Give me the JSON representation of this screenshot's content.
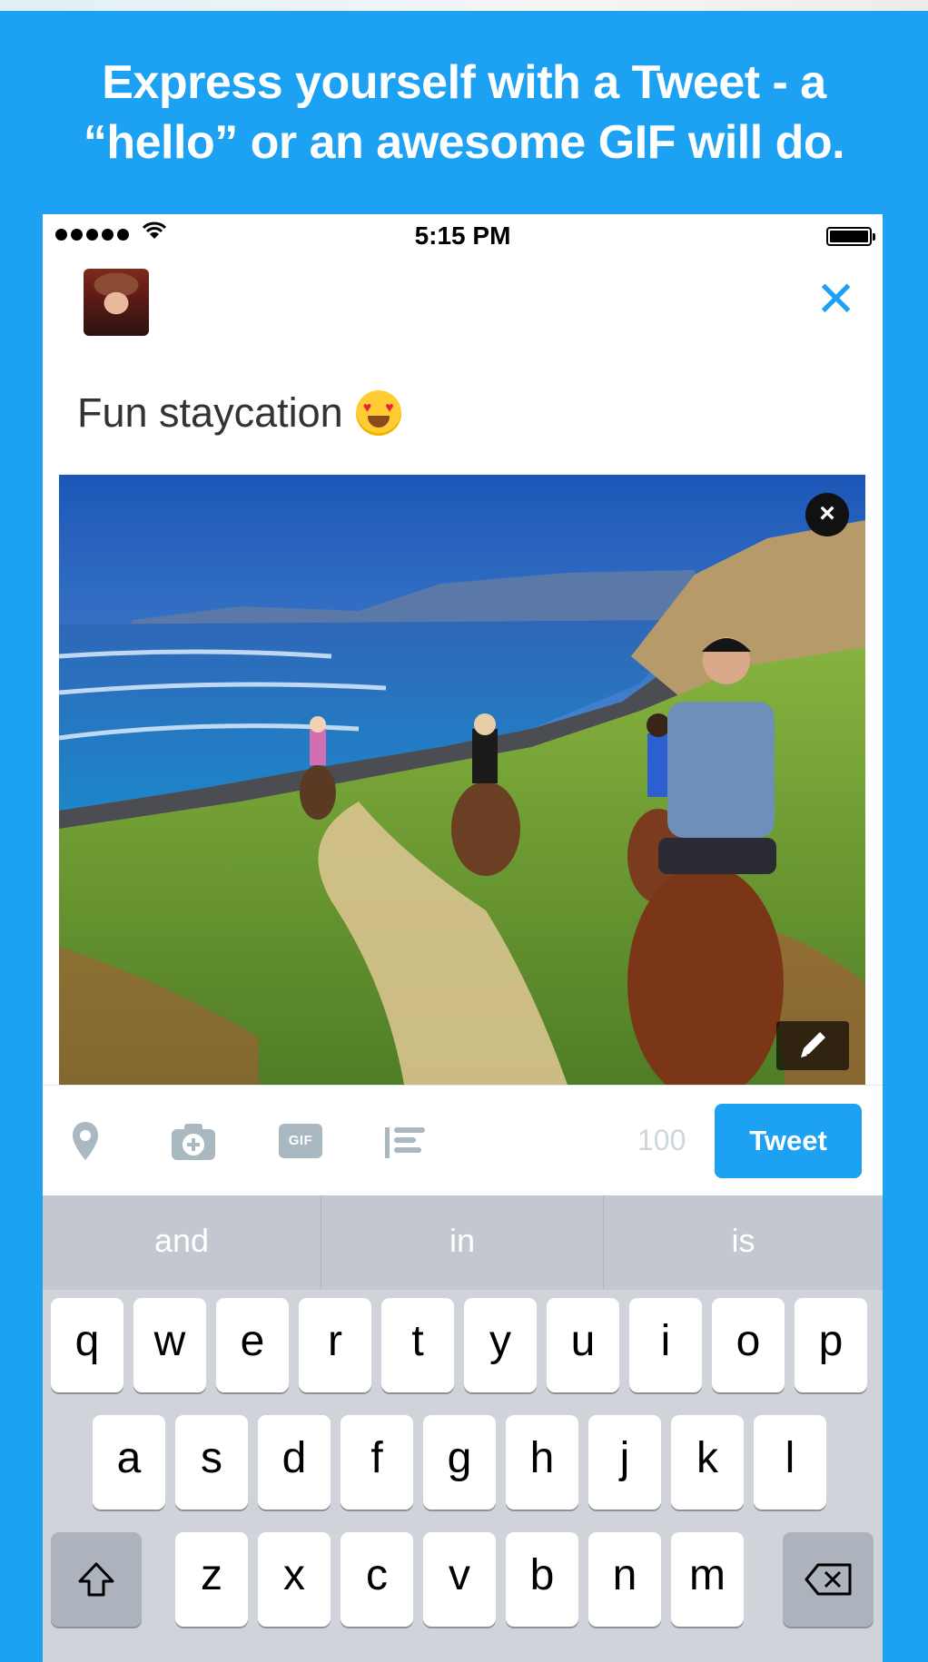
{
  "headline": {
    "line1": "Express yourself with a Tweet - a",
    "line2": "“hello” or an awesome GIF will do."
  },
  "status_bar": {
    "time": "5:15 PM",
    "signal_dots": 5
  },
  "compose": {
    "text": "Fun staycation",
    "emoji": "heart-eyes-emoji",
    "close_icon": "close-icon"
  },
  "media": {
    "remove_label": "×",
    "edit_icon": "pencil-icon"
  },
  "toolbar": {
    "gif_label": "GIF",
    "char_count": "100",
    "tweet_label": "Tweet",
    "icons": [
      "location-pin-icon",
      "camera-icon",
      "gif-icon",
      "poll-icon"
    ]
  },
  "predictions": [
    "and",
    "in",
    "is"
  ],
  "keyboard": {
    "row1": [
      "q",
      "w",
      "e",
      "r",
      "t",
      "y",
      "u",
      "i",
      "o",
      "p"
    ],
    "row2": [
      "a",
      "s",
      "d",
      "f",
      "g",
      "h",
      "j",
      "k",
      "l"
    ],
    "row3": [
      "z",
      "x",
      "c",
      "v",
      "b",
      "n",
      "m"
    ]
  },
  "colors": {
    "brand": "#1da1f2",
    "keyboard_bg": "#d0d3d9",
    "prediction_bg": "#c3c7cf"
  }
}
